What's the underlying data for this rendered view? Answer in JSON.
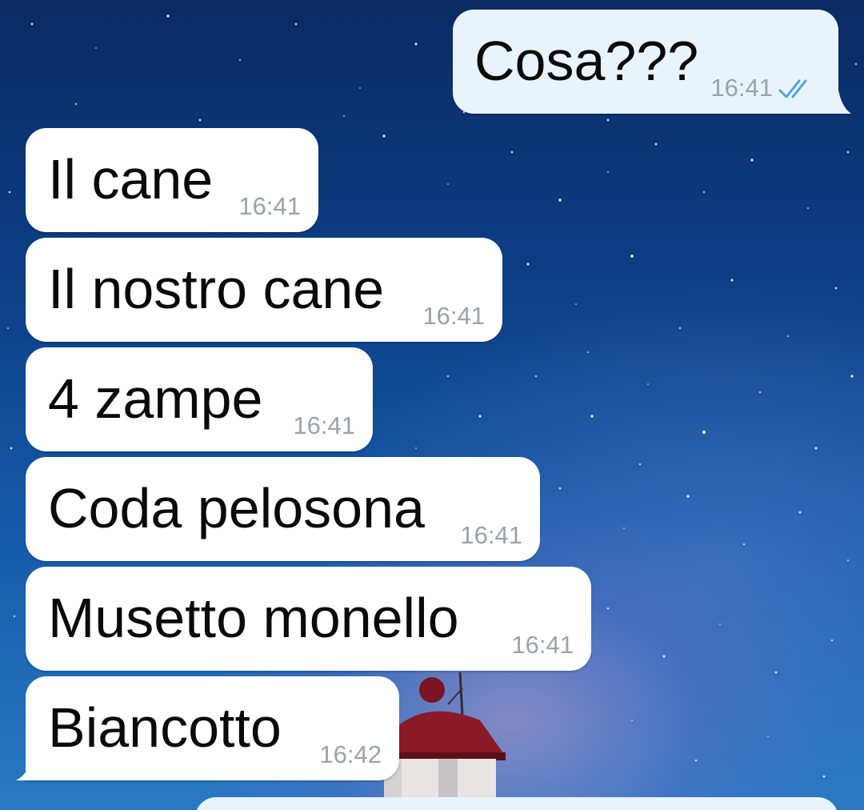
{
  "messages": [
    {
      "direction": "outgoing",
      "text": "Cosa???",
      "time": "16:41",
      "status": "read-double-check-icon"
    },
    {
      "direction": "incoming",
      "text": "Il cane",
      "time": "16:41"
    },
    {
      "direction": "incoming",
      "text": "Il nostro cane",
      "time": "16:41"
    },
    {
      "direction": "incoming",
      "text": "4 zampe",
      "time": "16:41"
    },
    {
      "direction": "incoming",
      "text": "Coda pelosona",
      "time": "16:41"
    },
    {
      "direction": "incoming",
      "text": "Musetto monello",
      "time": "16:41"
    },
    {
      "direction": "incoming",
      "text": "Biancotto",
      "time": "16:42"
    }
  ],
  "colors": {
    "incoming_bubble": "#ffffff",
    "outgoing_bubble": "#e8f3fb",
    "text": "#0a0a0a",
    "time": "#9aa3a9",
    "read_ticks": "#4fa3d8"
  }
}
